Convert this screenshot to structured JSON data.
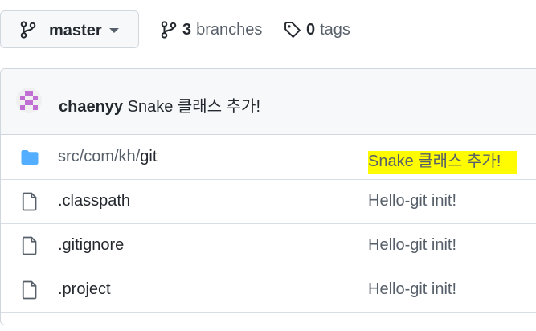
{
  "toolbar": {
    "branch": "master",
    "branches_count": "3",
    "branches_label": "branches",
    "tags_count": "0",
    "tags_label": "tags"
  },
  "latest_commit": {
    "author": "chaenyy",
    "message": "Snake 클래스 추가!"
  },
  "files": [
    {
      "type": "directory",
      "path_prefix": "src/com/kh/",
      "name": "git",
      "commit_message": "Snake 클래스 추가!",
      "highlighted": true
    },
    {
      "type": "file",
      "name": ".classpath",
      "commit_message": "Hello-git init!"
    },
    {
      "type": "file",
      "name": ".gitignore",
      "commit_message": "Hello-git init!"
    },
    {
      "type": "file",
      "name": ".project",
      "commit_message": "Hello-git init!"
    }
  ],
  "colors": {
    "folder": "#54aeff",
    "highlight": "#fffb00",
    "avatar": "#c06fd3"
  },
  "icons": [
    "git-branch-icon",
    "chevron-down-icon",
    "tag-icon",
    "folder-icon",
    "file-icon"
  ]
}
